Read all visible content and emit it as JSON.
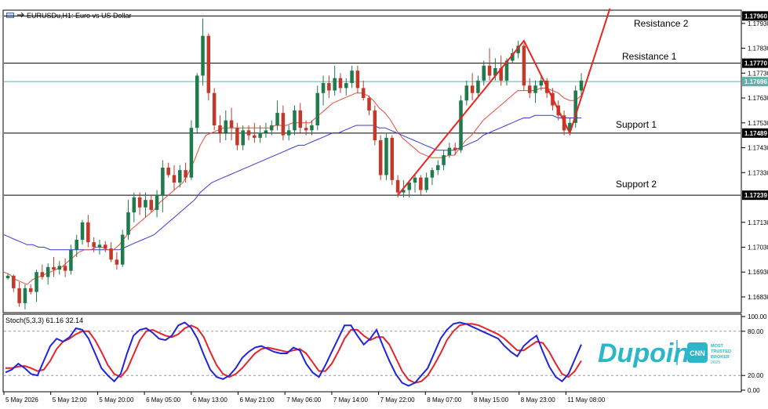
{
  "header": {
    "title": "EURUSDu,H1: Euro vs US Dollar",
    "stoch_label": "Stoch(5,3,3) 61.16 32.14"
  },
  "price_axis": {
    "ticks": [
      "1.17930",
      "1.17830",
      "1.17730",
      "1.17630",
      "1.17530",
      "1.17430",
      "1.17330",
      "1.17130",
      "1.17030",
      "1.16930",
      "1.16830"
    ],
    "current_price": "1.17696",
    "current_price_color": "#5fb3a8"
  },
  "levels": [
    {
      "name": "Resistance 2",
      "tag": "1.17960",
      "value": 1.1796
    },
    {
      "name": "Resistance 1",
      "tag": "1.17770",
      "value": 1.1777
    },
    {
      "name": "Support 1",
      "tag": "1.17489",
      "value": 1.17489
    },
    {
      "name": "Support 2",
      "tag": "1.17239",
      "value": 1.17239
    }
  ],
  "stoch_axis": {
    "ticks": [
      "100.00",
      "80.00",
      "20.00",
      "0.00"
    ]
  },
  "time_axis": {
    "labels": [
      "5 May 2026",
      "5 May 12:00",
      "5 May 20:00",
      "6 May 05:00",
      "6 May 13:00",
      "6 May 21:00",
      "7 May 06:00",
      "7 May 14:00",
      "7 May 22:00",
      "8 May 07:00",
      "8 May 15:00",
      "8 May 23:00",
      "11 May 08:00"
    ]
  },
  "watermark": {
    "brand": "Dupoin",
    "badge_text": "CNN",
    "badge_lines": [
      "MOST",
      "TRUSTED",
      "BROKER",
      "2025"
    ]
  },
  "colors": {
    "bull": "#1f7a4c",
    "bear": "#c0392b",
    "ma_fast": "#e74c3c",
    "ma_slow": "#3a3ad6",
    "stoch_k": "#2323d9",
    "stoch_d": "#e3242b",
    "pattern": "#e8251f",
    "brand": "#2bb7c9"
  },
  "chart_data": {
    "type": "candlestick",
    "symbol": "EURUSDu",
    "timeframe": "H1",
    "ylim": [
      1.1677,
      1.1798
    ],
    "candles": [
      {
        "o": 1.16905,
        "h": 1.16925,
        "l": 1.169,
        "c": 1.16915
      },
      {
        "o": 1.16915,
        "h": 1.1692,
        "l": 1.1685,
        "c": 1.16865
      },
      {
        "o": 1.16865,
        "h": 1.1689,
        "l": 1.1679,
        "c": 1.16805
      },
      {
        "o": 1.16805,
        "h": 1.1688,
        "l": 1.1678,
        "c": 1.16865
      },
      {
        "o": 1.16865,
        "h": 1.1688,
        "l": 1.1684,
        "c": 1.1685
      },
      {
        "o": 1.1685,
        "h": 1.1694,
        "l": 1.1681,
        "c": 1.1693
      },
      {
        "o": 1.1693,
        "h": 1.1696,
        "l": 1.169,
        "c": 1.1691
      },
      {
        "o": 1.1691,
        "h": 1.16965,
        "l": 1.1688,
        "c": 1.1695
      },
      {
        "o": 1.1695,
        "h": 1.1699,
        "l": 1.1691,
        "c": 1.1694
      },
      {
        "o": 1.1694,
        "h": 1.16975,
        "l": 1.1692,
        "c": 1.16955
      },
      {
        "o": 1.16955,
        "h": 1.16985,
        "l": 1.1691,
        "c": 1.16935
      },
      {
        "o": 1.16935,
        "h": 1.1704,
        "l": 1.1692,
        "c": 1.1702
      },
      {
        "o": 1.1702,
        "h": 1.1708,
        "l": 1.1699,
        "c": 1.1706
      },
      {
        "o": 1.1706,
        "h": 1.1714,
        "l": 1.1704,
        "c": 1.1713
      },
      {
        "o": 1.1713,
        "h": 1.1716,
        "l": 1.1703,
        "c": 1.1705
      },
      {
        "o": 1.1705,
        "h": 1.1707,
        "l": 1.1701,
        "c": 1.1703
      },
      {
        "o": 1.1703,
        "h": 1.1706,
        "l": 1.17,
        "c": 1.1704
      },
      {
        "o": 1.1704,
        "h": 1.17055,
        "l": 1.1701,
        "c": 1.17025
      },
      {
        "o": 1.17025,
        "h": 1.1705,
        "l": 1.1697,
        "c": 1.1698
      },
      {
        "o": 1.1698,
        "h": 1.1701,
        "l": 1.1694,
        "c": 1.1696
      },
      {
        "o": 1.1696,
        "h": 1.171,
        "l": 1.1695,
        "c": 1.1708
      },
      {
        "o": 1.1708,
        "h": 1.1722,
        "l": 1.1706,
        "c": 1.1717
      },
      {
        "o": 1.1717,
        "h": 1.1725,
        "l": 1.1713,
        "c": 1.1723
      },
      {
        "o": 1.1723,
        "h": 1.1725,
        "l": 1.1716,
        "c": 1.1719
      },
      {
        "o": 1.1719,
        "h": 1.1725,
        "l": 1.1715,
        "c": 1.1722
      },
      {
        "o": 1.1722,
        "h": 1.1724,
        "l": 1.1717,
        "c": 1.1718
      },
      {
        "o": 1.1718,
        "h": 1.1726,
        "l": 1.1715,
        "c": 1.1724
      },
      {
        "o": 1.1724,
        "h": 1.1738,
        "l": 1.1717,
        "c": 1.1735
      },
      {
        "o": 1.1735,
        "h": 1.1737,
        "l": 1.1731,
        "c": 1.1732
      },
      {
        "o": 1.1732,
        "h": 1.1736,
        "l": 1.1726,
        "c": 1.1729
      },
      {
        "o": 1.1729,
        "h": 1.1736,
        "l": 1.1727,
        "c": 1.1734
      },
      {
        "o": 1.1734,
        "h": 1.1737,
        "l": 1.1729,
        "c": 1.1731
      },
      {
        "o": 1.1731,
        "h": 1.1754,
        "l": 1.173,
        "c": 1.1751
      },
      {
        "o": 1.1751,
        "h": 1.1773,
        "l": 1.1749,
        "c": 1.1772
      },
      {
        "o": 1.1772,
        "h": 1.1795,
        "l": 1.1768,
        "c": 1.1788
      },
      {
        "o": 1.1788,
        "h": 1.1789,
        "l": 1.1762,
        "c": 1.1765
      },
      {
        "o": 1.1765,
        "h": 1.1767,
        "l": 1.175,
        "c": 1.1752
      },
      {
        "o": 1.1752,
        "h": 1.1756,
        "l": 1.1745,
        "c": 1.1749
      },
      {
        "o": 1.1749,
        "h": 1.1758,
        "l": 1.1746,
        "c": 1.1754
      },
      {
        "o": 1.1754,
        "h": 1.1759,
        "l": 1.1746,
        "c": 1.1751
      },
      {
        "o": 1.1751,
        "h": 1.1753,
        "l": 1.1742,
        "c": 1.1744
      },
      {
        "o": 1.1744,
        "h": 1.1752,
        "l": 1.1742,
        "c": 1.175
      },
      {
        "o": 1.175,
        "h": 1.1752,
        "l": 1.1746,
        "c": 1.1748
      },
      {
        "o": 1.1748,
        "h": 1.1753,
        "l": 1.1745,
        "c": 1.1747
      },
      {
        "o": 1.1747,
        "h": 1.1752,
        "l": 1.1745,
        "c": 1.1749
      },
      {
        "o": 1.1749,
        "h": 1.1753,
        "l": 1.1747,
        "c": 1.175
      },
      {
        "o": 1.175,
        "h": 1.1754,
        "l": 1.1748,
        "c": 1.1752
      },
      {
        "o": 1.1752,
        "h": 1.1762,
        "l": 1.175,
        "c": 1.1757
      },
      {
        "o": 1.1757,
        "h": 1.176,
        "l": 1.1746,
        "c": 1.1748
      },
      {
        "o": 1.1748,
        "h": 1.1752,
        "l": 1.1746,
        "c": 1.175
      },
      {
        "o": 1.175,
        "h": 1.176,
        "l": 1.1748,
        "c": 1.1758
      },
      {
        "o": 1.1758,
        "h": 1.1761,
        "l": 1.1749,
        "c": 1.1751
      },
      {
        "o": 1.1751,
        "h": 1.1754,
        "l": 1.1748,
        "c": 1.175
      },
      {
        "o": 1.175,
        "h": 1.1754,
        "l": 1.1748,
        "c": 1.1752
      },
      {
        "o": 1.1752,
        "h": 1.1768,
        "l": 1.175,
        "c": 1.1765
      },
      {
        "o": 1.1765,
        "h": 1.1772,
        "l": 1.176,
        "c": 1.1769
      },
      {
        "o": 1.1769,
        "h": 1.1772,
        "l": 1.1763,
        "c": 1.1766
      },
      {
        "o": 1.1766,
        "h": 1.1776,
        "l": 1.1764,
        "c": 1.1771
      },
      {
        "o": 1.1771,
        "h": 1.1773,
        "l": 1.1765,
        "c": 1.1767
      },
      {
        "o": 1.1767,
        "h": 1.1771,
        "l": 1.1764,
        "c": 1.1769
      },
      {
        "o": 1.1769,
        "h": 1.1776,
        "l": 1.1767,
        "c": 1.1774
      },
      {
        "o": 1.1774,
        "h": 1.1776,
        "l": 1.1765,
        "c": 1.1767
      },
      {
        "o": 1.1767,
        "h": 1.177,
        "l": 1.1762,
        "c": 1.1763
      },
      {
        "o": 1.1763,
        "h": 1.1764,
        "l": 1.1756,
        "c": 1.1758
      },
      {
        "o": 1.1758,
        "h": 1.176,
        "l": 1.1744,
        "c": 1.1746
      },
      {
        "o": 1.1746,
        "h": 1.1748,
        "l": 1.173,
        "c": 1.1732
      },
      {
        "o": 1.1732,
        "h": 1.1749,
        "l": 1.173,
        "c": 1.1747
      },
      {
        "o": 1.1747,
        "h": 1.1748,
        "l": 1.1728,
        "c": 1.173
      },
      {
        "o": 1.173,
        "h": 1.1732,
        "l": 1.1723,
        "c": 1.1725
      },
      {
        "o": 1.1725,
        "h": 1.173,
        "l": 1.1723,
        "c": 1.1726
      },
      {
        "o": 1.1726,
        "h": 1.173,
        "l": 1.1723,
        "c": 1.1729
      },
      {
        "o": 1.1729,
        "h": 1.1732,
        "l": 1.1725,
        "c": 1.1731
      },
      {
        "o": 1.1731,
        "h": 1.1732,
        "l": 1.1724,
        "c": 1.1726
      },
      {
        "o": 1.1726,
        "h": 1.1733,
        "l": 1.1725,
        "c": 1.1731
      },
      {
        "o": 1.1731,
        "h": 1.1735,
        "l": 1.1728,
        "c": 1.1734
      },
      {
        "o": 1.1734,
        "h": 1.1738,
        "l": 1.1732,
        "c": 1.1736
      },
      {
        "o": 1.1736,
        "h": 1.1742,
        "l": 1.1734,
        "c": 1.174
      },
      {
        "o": 1.174,
        "h": 1.1745,
        "l": 1.1739,
        "c": 1.1743
      },
      {
        "o": 1.1743,
        "h": 1.1745,
        "l": 1.174,
        "c": 1.1742
      },
      {
        "o": 1.1742,
        "h": 1.1764,
        "l": 1.1741,
        "c": 1.1762
      },
      {
        "o": 1.1762,
        "h": 1.177,
        "l": 1.176,
        "c": 1.1768
      },
      {
        "o": 1.1768,
        "h": 1.1773,
        "l": 1.1762,
        "c": 1.1765
      },
      {
        "o": 1.1765,
        "h": 1.1772,
        "l": 1.1763,
        "c": 1.177
      },
      {
        "o": 1.177,
        "h": 1.1778,
        "l": 1.1768,
        "c": 1.1776
      },
      {
        "o": 1.1776,
        "h": 1.1783,
        "l": 1.177,
        "c": 1.1772
      },
      {
        "o": 1.1772,
        "h": 1.1779,
        "l": 1.177,
        "c": 1.1775
      },
      {
        "o": 1.1775,
        "h": 1.178,
        "l": 1.1768,
        "c": 1.177
      },
      {
        "o": 1.177,
        "h": 1.1779,
        "l": 1.1768,
        "c": 1.1778
      },
      {
        "o": 1.1778,
        "h": 1.1783,
        "l": 1.1777,
        "c": 1.1781
      },
      {
        "o": 1.1781,
        "h": 1.1786,
        "l": 1.1779,
        "c": 1.1784
      },
      {
        "o": 1.1784,
        "h": 1.1785,
        "l": 1.1766,
        "c": 1.1768
      },
      {
        "o": 1.1768,
        "h": 1.1771,
        "l": 1.1763,
        "c": 1.1765
      },
      {
        "o": 1.1765,
        "h": 1.177,
        "l": 1.1761,
        "c": 1.1768
      },
      {
        "o": 1.1768,
        "h": 1.1772,
        "l": 1.1766,
        "c": 1.177
      },
      {
        "o": 1.177,
        "h": 1.1771,
        "l": 1.1763,
        "c": 1.1765
      },
      {
        "o": 1.1765,
        "h": 1.1767,
        "l": 1.1758,
        "c": 1.176
      },
      {
        "o": 1.176,
        "h": 1.1762,
        "l": 1.1754,
        "c": 1.1756
      },
      {
        "o": 1.1756,
        "h": 1.1758,
        "l": 1.1748,
        "c": 1.175
      },
      {
        "o": 1.175,
        "h": 1.1755,
        "l": 1.1748,
        "c": 1.1753
      },
      {
        "o": 1.1753,
        "h": 1.1768,
        "l": 1.1751,
        "c": 1.1766
      },
      {
        "o": 1.1766,
        "h": 1.1773,
        "l": 1.1764,
        "c": 1.177
      }
    ],
    "ma_fast": [
      1.1693,
      1.1692,
      1.169,
      1.1689,
      1.1688,
      1.169,
      1.1691,
      1.1692,
      1.1693,
      1.1694,
      1.1695,
      1.1697,
      1.1699,
      1.1701,
      1.1702,
      1.1702,
      1.1703,
      1.1703,
      1.1702,
      1.1702,
      1.1704,
      1.1707,
      1.171,
      1.1712,
      1.1714,
      1.1716,
      1.1718,
      1.1721,
      1.1723,
      1.1725,
      1.1727,
      1.1729,
      1.1733,
      1.1738,
      1.1744,
      1.1748,
      1.1749,
      1.175,
      1.1751,
      1.1751,
      1.1751,
      1.1751,
      1.1751,
      1.1751,
      1.1751,
      1.1751,
      1.1751,
      1.1752,
      1.1752,
      1.1752,
      1.1753,
      1.1753,
      1.1753,
      1.1753,
      1.1755,
      1.1757,
      1.1759,
      1.1761,
      1.1762,
      1.1763,
      1.1764,
      1.1765,
      1.1765,
      1.1764,
      1.1762,
      1.1759,
      1.1757,
      1.1754,
      1.175,
      1.1747,
      1.1745,
      1.1743,
      1.1741,
      1.174,
      1.1739,
      1.1739,
      1.1739,
      1.174,
      1.174,
      1.1743,
      1.1746,
      1.1748,
      1.1751,
      1.1754,
      1.1756,
      1.1758,
      1.176,
      1.1762,
      1.1764,
      1.1766,
      1.1766,
      1.1766,
      1.1766,
      1.1767,
      1.1767,
      1.1766,
      1.1765,
      1.1763,
      1.1762,
      1.1762,
      1.1764
    ],
    "ma_slow": [
      1.1708,
      1.1707,
      1.1706,
      1.1705,
      1.1704,
      1.1704,
      1.1703,
      1.1703,
      1.1702,
      1.1702,
      1.1702,
      1.1702,
      1.1702,
      1.1702,
      1.1702,
      1.1702,
      1.1702,
      1.1702,
      1.1702,
      1.1702,
      1.1702,
      1.1703,
      1.1704,
      1.1705,
      1.1706,
      1.1707,
      1.1708,
      1.171,
      1.1712,
      1.1714,
      1.1716,
      1.1718,
      1.172,
      1.1722,
      1.1725,
      1.1727,
      1.1729,
      1.173,
      1.1731,
      1.1732,
      1.1733,
      1.1734,
      1.1735,
      1.1736,
      1.1737,
      1.1738,
      1.1739,
      1.174,
      1.1741,
      1.1742,
      1.1743,
      1.1744,
      1.1744,
      1.1745,
      1.1746,
      1.1747,
      1.1748,
      1.1749,
      1.1749,
      1.175,
      1.1751,
      1.1752,
      1.1752,
      1.1752,
      1.1752,
      1.1751,
      1.1751,
      1.175,
      1.1749,
      1.1748,
      1.1747,
      1.1746,
      1.1745,
      1.1744,
      1.1743,
      1.1742,
      1.1742,
      1.1742,
      1.1742,
      1.1743,
      1.1744,
      1.1745,
      1.1746,
      1.1748,
      1.1749,
      1.175,
      1.1751,
      1.1752,
      1.1753,
      1.1754,
      1.1755,
      1.1755,
      1.1756,
      1.1756,
      1.1756,
      1.1756,
      1.1755,
      1.1755,
      1.1755,
      1.1755,
      1.1755
    ],
    "pattern_path": [
      {
        "i": 68,
        "price": 1.17239
      },
      {
        "i": 90,
        "price": 1.1786
      },
      {
        "i": 98,
        "price": 1.17489
      },
      {
        "i": 105,
        "price": 1.1799
      }
    ],
    "stoch_k": [
      24,
      28,
      36,
      30,
      22,
      20,
      40,
      60,
      70,
      66,
      72,
      84,
      82,
      70,
      50,
      30,
      20,
      12,
      22,
      50,
      74,
      82,
      84,
      78,
      70,
      68,
      74,
      88,
      92,
      85,
      70,
      48,
      28,
      18,
      15,
      20,
      30,
      44,
      52,
      58,
      60,
      56,
      52,
      50,
      50,
      58,
      54,
      36,
      24,
      18,
      34,
      52,
      70,
      88,
      88,
      74,
      62,
      70,
      82,
      60,
      40,
      22,
      10,
      6,
      10,
      20,
      30,
      50,
      70,
      82,
      90,
      92,
      90,
      86,
      82,
      78,
      74,
      70,
      60,
      52,
      46,
      60,
      68,
      74,
      52,
      32,
      18,
      12,
      22,
      42,
      62
    ],
    "stoch_d": [
      30,
      30,
      32,
      33,
      30,
      26,
      28,
      40,
      56,
      66,
      70,
      76,
      80,
      80,
      68,
      52,
      34,
      22,
      18,
      28,
      48,
      68,
      80,
      82,
      78,
      74,
      72,
      76,
      84,
      88,
      84,
      72,
      52,
      34,
      22,
      18,
      22,
      30,
      40,
      50,
      56,
      58,
      56,
      54,
      52,
      54,
      56,
      50,
      38,
      26,
      26,
      36,
      52,
      70,
      82,
      82,
      74,
      68,
      72,
      72,
      62,
      44,
      26,
      14,
      10,
      12,
      20,
      34,
      50,
      68,
      80,
      88,
      90,
      90,
      88,
      84,
      80,
      76,
      70,
      62,
      54,
      54,
      60,
      66,
      64,
      52,
      36,
      22,
      18,
      26,
      40
    ]
  }
}
